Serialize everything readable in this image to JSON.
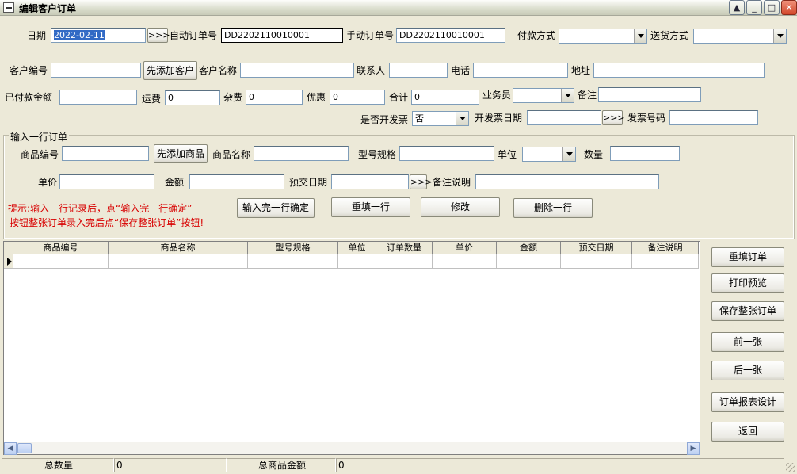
{
  "window": {
    "title": "编辑客户订单"
  },
  "header": {
    "date_label": "日期",
    "date_value": "2022-02-11",
    "date_picker": ">>>",
    "auto_order_label": "自动订单号",
    "auto_order_value": "DD2202110010001",
    "manual_order_label": "手动订单号",
    "manual_order_value": "DD2202110010001",
    "payment_label": "付款方式",
    "payment_value": "",
    "delivery_label": "送货方式",
    "delivery_value": "",
    "customer_no_label": "客户编号",
    "add_customer_button": "先添加客户",
    "customer_name_label": "客户名称",
    "contact_label": "联系人",
    "phone_label": "电话",
    "address_label": "地址",
    "paid_label": "已付款金额",
    "freight_label": "运费",
    "freight_value": "0",
    "misc_label": "杂费",
    "misc_value": "0",
    "discount_label": "优惠",
    "discount_value": "0",
    "total_label": "合计",
    "total_value": "0",
    "salesman_label": "业务员",
    "salesman_value": "",
    "remark_label": "备注",
    "invoice_label": "是否开发票",
    "invoice_value": "否",
    "invoice_date_label": "开发票日期",
    "invoice_date_picker": ">>>",
    "invoice_no_label": "发票号码"
  },
  "line_entry": {
    "group_title": "输入一行订单",
    "product_no_label": "商品编号",
    "add_product_button": "先添加商品",
    "product_name_label": "商品名称",
    "spec_label": "型号规格",
    "unit_label": "单位",
    "unit_value": "",
    "qty_label": "数量",
    "price_label": "单价",
    "amount_label": "金额",
    "due_date_label": "预交日期",
    "due_date_picker": ">>>",
    "note_label": "备注说明",
    "tip_line1": "提示:输入一行记录后，点“输入完一行确定”",
    "tip_line2": "按钮整张订单录入完后点“保存整张订单”按钮!",
    "confirm_button": "输入完一行确定",
    "refill_button": "重填一行",
    "modify_button": "修改",
    "delete_button": "删除一行"
  },
  "grid": {
    "columns": [
      "商品编号",
      "商品名称",
      "型号规格",
      "单位",
      "订单数量",
      "单价",
      "金额",
      "预交日期",
      "备注说明"
    ]
  },
  "side_buttons": {
    "refill_order": "重填订单",
    "print_preview": "打印预览",
    "save_order": "保存整张订单",
    "prev": "前一张",
    "next": "后一张",
    "report_design": "订单报表设计",
    "back": "返回"
  },
  "status": {
    "total_qty_label": "总数量",
    "total_qty_value": "0",
    "total_amount_label": "总商品金额",
    "total_amount_value": "0"
  }
}
